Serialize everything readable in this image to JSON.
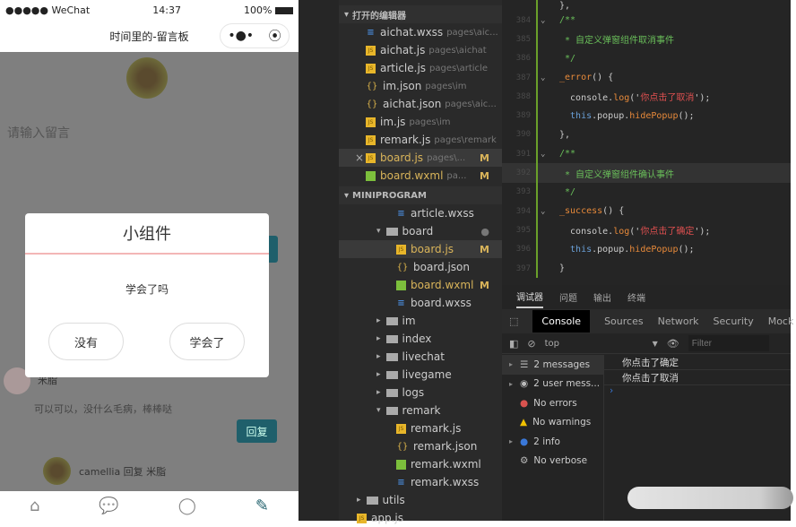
{
  "phone": {
    "status": {
      "carrier": "●●●●● WeChat",
      "time": "14:37",
      "battery": "100%"
    },
    "nav_title": "时间里的-留言板",
    "capsule": {
      "more": "•●•",
      "close": "⦿"
    },
    "input_placeholder": "请输入留言",
    "dialog": {
      "title": "小组件",
      "message": "学会了吗",
      "cancel": "没有",
      "confirm": "学会了"
    },
    "comment": {
      "author": "米脂",
      "text": "可以可以，没什么毛病，棒棒哒",
      "reply_label": "回复"
    },
    "subreply": {
      "text": "camellia 回复 米脂"
    },
    "tabbar": [
      {
        "icon": "home-icon",
        "glyph": "⌂"
      },
      {
        "icon": "chat-icon",
        "glyph": "💬"
      },
      {
        "icon": "location-icon",
        "glyph": "◯"
      },
      {
        "icon": "edit-icon",
        "glyph": "✎"
      }
    ],
    "accent": "#1f5f6b"
  },
  "explorer": {
    "open_editors_title": "打开的编辑器",
    "open_editors": [
      {
        "type": "wxss",
        "name": "aichat.wxss",
        "path": "pages\\aic..."
      },
      {
        "type": "js",
        "name": "aichat.js",
        "path": "pages\\aichat"
      },
      {
        "type": "js",
        "name": "article.js",
        "path": "pages\\article"
      },
      {
        "type": "json",
        "name": "im.json",
        "path": "pages\\im"
      },
      {
        "type": "json",
        "name": "aichat.json",
        "path": "pages\\aic..."
      },
      {
        "type": "js",
        "name": "im.js",
        "path": "pages\\im"
      },
      {
        "type": "js",
        "name": "remark.js",
        "path": "pages\\remark"
      },
      {
        "type": "js",
        "name": "board.js",
        "path": "pages\\...",
        "badge": "M",
        "active": true
      },
      {
        "type": "wxml",
        "name": "board.wxml",
        "path": "pa...",
        "badge": "M"
      }
    ],
    "project_title": "MINIPROGRAM",
    "tree": [
      {
        "type": "wxss",
        "name": "article.wxss",
        "depth": 2
      },
      {
        "type": "folder-open",
        "name": "board",
        "depth": 1,
        "badge": "●"
      },
      {
        "type": "js",
        "name": "board.js",
        "depth": 2,
        "badge": "M",
        "active": true
      },
      {
        "type": "json",
        "name": "board.json",
        "depth": 2
      },
      {
        "type": "wxml",
        "name": "board.wxml",
        "depth": 2,
        "badge": "M"
      },
      {
        "type": "wxss",
        "name": "board.wxss",
        "depth": 2
      },
      {
        "type": "folder",
        "name": "im",
        "depth": 1
      },
      {
        "type": "folder",
        "name": "index",
        "depth": 1
      },
      {
        "type": "folder",
        "name": "livechat",
        "depth": 1
      },
      {
        "type": "folder",
        "name": "livegame",
        "depth": 1
      },
      {
        "type": "folder",
        "name": "logs",
        "depth": 1
      },
      {
        "type": "folder-open",
        "name": "remark",
        "depth": 1
      },
      {
        "type": "js",
        "name": "remark.js",
        "depth": 2
      },
      {
        "type": "json",
        "name": "remark.json",
        "depth": 2
      },
      {
        "type": "wxml",
        "name": "remark.wxml",
        "depth": 2
      },
      {
        "type": "wxss",
        "name": "remark.wxss",
        "depth": 2
      },
      {
        "type": "folder",
        "name": "utils",
        "depth": 0
      },
      {
        "type": "js",
        "name": "app.js",
        "depth": 0
      }
    ]
  },
  "editor": {
    "lines": [
      {
        "n": "384",
        "fold": true,
        "parts": [
          [
            "cm",
            "/**"
          ]
        ]
      },
      {
        "n": "385",
        "parts": [
          [
            "cm",
            " * 自定义弹窗组件取消事件"
          ]
        ]
      },
      {
        "n": "386",
        "parts": [
          [
            "cm",
            " */"
          ]
        ]
      },
      {
        "n": "387",
        "fold": true,
        "parts": [
          [
            "fn",
            "_error"
          ],
          [
            "pl",
            "() {"
          ]
        ]
      },
      {
        "n": "388",
        "parts": [
          [
            "pl",
            "  console."
          ],
          [
            "fn",
            "log"
          ],
          [
            "pl",
            "('"
          ],
          [
            "str",
            "你点击了取消"
          ],
          [
            "pl",
            "');"
          ]
        ]
      },
      {
        "n": "389",
        "parts": [
          [
            "kw",
            "  this"
          ],
          [
            "pl",
            ".popup."
          ],
          [
            "fn",
            "hidePopup"
          ],
          [
            "pl",
            "();"
          ]
        ]
      },
      {
        "n": "390",
        "parts": [
          [
            "pl",
            "},"
          ]
        ]
      },
      {
        "n": "391",
        "fold": true,
        "parts": [
          [
            "cm",
            "/**"
          ]
        ]
      },
      {
        "n": "392",
        "hl": true,
        "parts": [
          [
            "cm",
            " * 自定义弹窗组件确认事件"
          ]
        ]
      },
      {
        "n": "393",
        "parts": [
          [
            "cm",
            " */"
          ]
        ]
      },
      {
        "n": "394",
        "fold": true,
        "parts": [
          [
            "fn",
            "_success"
          ],
          [
            "pl",
            "() {"
          ]
        ]
      },
      {
        "n": "395",
        "parts": [
          [
            "pl",
            "  console."
          ],
          [
            "fn",
            "log"
          ],
          [
            "pl",
            "('"
          ],
          [
            "str",
            "你点击了确定"
          ],
          [
            "pl",
            "');"
          ]
        ]
      },
      {
        "n": "396",
        "parts": [
          [
            "kw",
            "  this"
          ],
          [
            "pl",
            ".popup."
          ],
          [
            "fn",
            "hidePopup"
          ],
          [
            "pl",
            "();"
          ]
        ]
      },
      {
        "n": "397",
        "parts": [
          [
            "pl",
            "}"
          ]
        ]
      }
    ]
  },
  "devtools": {
    "panel_tabs": [
      "调试器",
      "问题",
      "输出",
      "终端"
    ],
    "console_tabs": [
      "Console",
      "Sources",
      "Network",
      "Security",
      "Mock"
    ],
    "context": "top",
    "filter_placeholder": "Filter",
    "sidebar": [
      {
        "icon": "list-icon",
        "glyph": "☰",
        "label": "2 messages",
        "expand": true
      },
      {
        "icon": "user-icon",
        "glyph": "◉",
        "label": "2 user mess...",
        "expand": true
      },
      {
        "icon": "error-icon",
        "glyph": "●",
        "label": "No errors"
      },
      {
        "icon": "warning-icon",
        "glyph": "▲",
        "label": "No warnings"
      },
      {
        "icon": "info-icon",
        "glyph": "●",
        "label": "2 info",
        "expand": true
      },
      {
        "icon": "verbose-icon",
        "glyph": "⚙",
        "label": "No verbose"
      }
    ],
    "output": [
      "你点击了确定",
      "你点击了取消"
    ],
    "prompt": "›"
  }
}
